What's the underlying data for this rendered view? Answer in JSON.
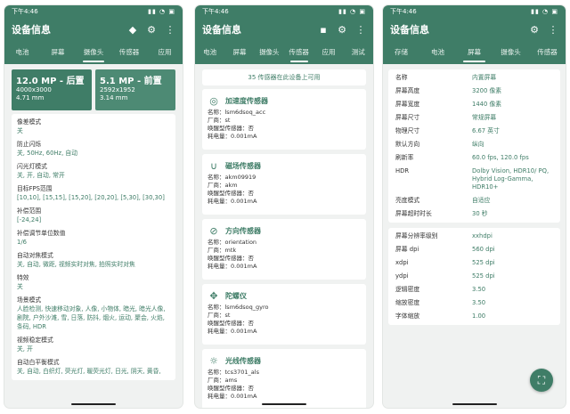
{
  "status_time": "下午4:46",
  "status_icons": "▮▮ ◔ ▣",
  "app_title": "设备信息",
  "colors": {
    "primary": "#3f7d67"
  },
  "phone1": {
    "tabs": [
      "电池",
      "屏幕",
      "摄像头",
      "传感器",
      "应用"
    ],
    "active_tab": 2,
    "cameras": [
      {
        "title": "12.0 MP - 后置",
        "resolution": "4000x3000",
        "focal": "4.71 mm"
      },
      {
        "title": "5.1 MP - 前置",
        "resolution": "2592x1952",
        "focal": "3.14 mm"
      }
    ],
    "props": [
      {
        "label": "像差模式",
        "value": "关"
      },
      {
        "label": "防止闪烁",
        "value": "关, 50Hz, 60Hz, 自动"
      },
      {
        "label": "闪光灯模式",
        "value": "关, 开, 自动, 常开"
      },
      {
        "label": "目标FPS范围",
        "value": "[10,10], [15,15], [15,20], [20,20], [5,30], [30,30]"
      },
      {
        "label": "补偿范围",
        "value": "[-24,24]"
      },
      {
        "label": "补偿调节单位数值",
        "value": "1/6"
      },
      {
        "label": "自动对焦模式",
        "value": "关, 自动, 微距, 视频实时对焦, 拍照实时对焦"
      },
      {
        "label": "特效",
        "value": "关"
      },
      {
        "label": "场景模式",
        "value": "人脸检测, 快速移动对象, 人像, 小物体, 暗光, 暗光人像, 剧院, 户外沙滩, 雪, 日落, 防抖, 烟火, 运动, 聚会, 火焰, 条码, HDR"
      },
      {
        "label": "视频稳定模式",
        "value": "关, 开"
      },
      {
        "label": "自动白平衡模式",
        "value": "关, 自动, 白织灯, 荧光灯, 暖荧光灯, 日光, 阴天, 黄昏,"
      }
    ]
  },
  "phone2": {
    "tabs": [
      "电池",
      "屏幕",
      "摄像头",
      "传感器",
      "应用",
      "测试"
    ],
    "active_tab": 3,
    "sensor_count": "35 传感器在此设备上可用",
    "sensors": [
      {
        "icon": "accelerometer-icon",
        "glyph": "◎",
        "name": "加速度传感器",
        "model": "名称：lsm6dsoq_acc",
        "vendor": "厂商：st",
        "wakeup": "唤醒型传感器：否",
        "power": "耗电量：0.001mA"
      },
      {
        "icon": "magnet-icon",
        "glyph": "∪",
        "name": "磁场传感器",
        "model": "名称：akm09919",
        "vendor": "厂商：akm",
        "wakeup": "唤醒型传感器：否",
        "power": "耗电量：0.001mA"
      },
      {
        "icon": "compass-icon",
        "glyph": "⊘",
        "name": "方向传感器",
        "model": "名称：orientation",
        "vendor": "厂商：mtk",
        "wakeup": "唤醒型传感器：否",
        "power": "耗电量：0.001mA"
      },
      {
        "icon": "gyroscope-icon",
        "glyph": "✥",
        "name": "陀螺仪",
        "model": "名称：lsm6dsoq_gyro",
        "vendor": "厂商：st",
        "wakeup": "唤醒型传感器：否",
        "power": "耗电量：0.001mA"
      },
      {
        "icon": "light-sensor-icon",
        "glyph": "☼",
        "name": "光线传感器",
        "model": "名称：tcs3701_als",
        "vendor": "厂商：ams",
        "wakeup": "唤醒型传感器：否",
        "power": "耗电量：0.001mA"
      }
    ]
  },
  "phone3": {
    "tabs": [
      "存储",
      "电池",
      "屏幕",
      "摄像头",
      "传感器"
    ],
    "active_tab": 2,
    "display_info": [
      {
        "key": "名称",
        "value": "内置屏幕"
      },
      {
        "key": "屏幕高度",
        "value": "3200 像素"
      },
      {
        "key": "屏幕宽度",
        "value": "1440 像素"
      },
      {
        "key": "屏幕尺寸",
        "value": "常规屏幕"
      },
      {
        "key": "物理尺寸",
        "value": "6.67 英寸"
      },
      {
        "key": "默认方向",
        "value": "纵向"
      },
      {
        "key": "刷新率",
        "value": "60.0 fps, 120.0 fps"
      },
      {
        "key": "HDR",
        "value": "Dolby Vision, HDR10/ PQ, Hybrid Log-Gamma, HDR10+"
      },
      {
        "key": "亮度模式",
        "value": "自适应"
      },
      {
        "key": "屏幕超时时长",
        "value": "30 秒"
      }
    ],
    "density_info": [
      {
        "key": "屏幕分辨率级别",
        "value": "xxhdpi"
      },
      {
        "key": "屏幕 dpi",
        "value": "560 dpi"
      },
      {
        "key": "xdpi",
        "value": "525 dpi"
      },
      {
        "key": "ydpi",
        "value": "525 dpi"
      },
      {
        "key": "逻辑密度",
        "value": "3.50"
      },
      {
        "key": "缩放密度",
        "value": "3.50"
      },
      {
        "key": "字体缩放",
        "value": "1.00"
      }
    ]
  }
}
